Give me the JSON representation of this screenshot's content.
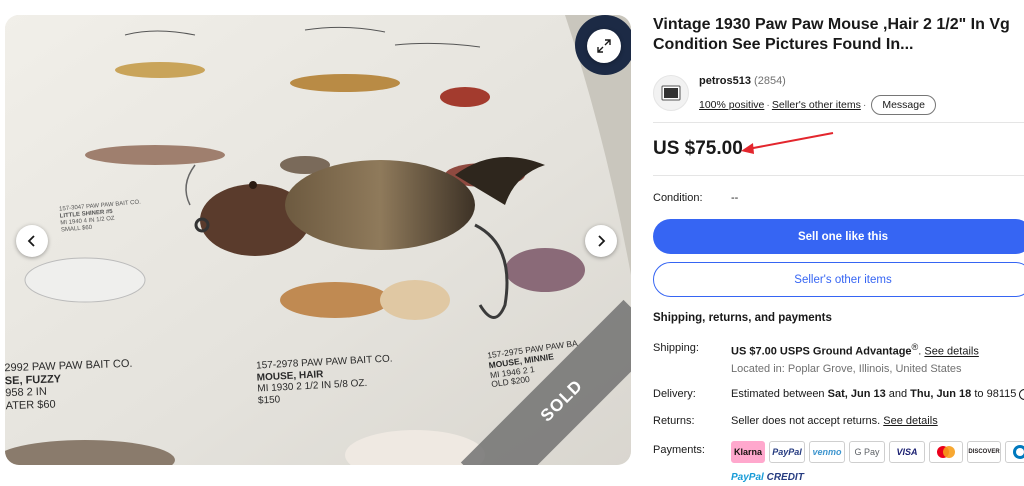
{
  "gallery": {
    "sold_label": "SOLD",
    "catalog": {
      "left_code": "2992 PAW PAW BAIT CO.",
      "left_name": "SE, FUZZY",
      "left_year": "958   2 IN",
      "left_price": "ATER  $60",
      "mid_code": "157-2978  PAW PAW BAIT CO.",
      "mid_name": "MOUSE,  HAIR",
      "mid_year": "MI   1930   2 1/2 IN    5/8 OZ.",
      "mid_price": "$150",
      "right_code": "157-2975  PAW PAW BA",
      "right_name": "MOUSE,  MINNIE",
      "right_year": "MI   1946   2 1",
      "right_price": "OLD  $200",
      "upper_code": "157-3047  PAW PAW BAIT CO.",
      "upper_name": "LITTLE SHINER  #5",
      "upper_year": "MI   1940   4 IN    1/2 OZ",
      "upper_price": "SMALL  $60"
    }
  },
  "listing": {
    "title": "Vintage 1930 Paw Paw Mouse ,Hair 2 1/2\" In Vg Condition See Pictures Found In...",
    "price": "US $75.00",
    "condition_label": "Condition:",
    "condition_value": "--"
  },
  "seller": {
    "name": "petros513",
    "feedback_count": "(2854)",
    "positive": "100% positive",
    "other_items_link": "Seller's other items",
    "message_button": "Message"
  },
  "actions": {
    "sell_one": "Sell one like this",
    "sellers_other_items": "Seller's other items"
  },
  "shipping": {
    "heading": "Shipping, returns, and payments",
    "shipping_label": "Shipping:",
    "shipping_value": "US $7.00 USPS Ground Advantage",
    "shipping_reg": "®",
    "see_details": "See details",
    "location": "Located in: Poplar Grove, Illinois, United States",
    "delivery_label": "Delivery:",
    "delivery_prefix": "Estimated between ",
    "delivery_start": "Sat, Jun 13",
    "delivery_and": " and ",
    "delivery_end": "Thu, Jun 18",
    "delivery_suffix": " to 98115",
    "returns_label": "Returns:",
    "returns_value": "Seller does not accept returns.",
    "returns_details": "See details",
    "payments_label": "Payments:",
    "payment_methods": [
      "Klarna",
      "PayPal",
      "venmo",
      "G Pay",
      "VISA",
      "Mastercard",
      "DISCOVER",
      "Diners"
    ],
    "paypal_credit_a": "PayPal",
    "paypal_credit_b": " CREDIT"
  },
  "colors": {
    "primary": "#3665f3",
    "sold_ribbon": "#6e6e6e",
    "annotation_arrow": "#e3262d"
  }
}
